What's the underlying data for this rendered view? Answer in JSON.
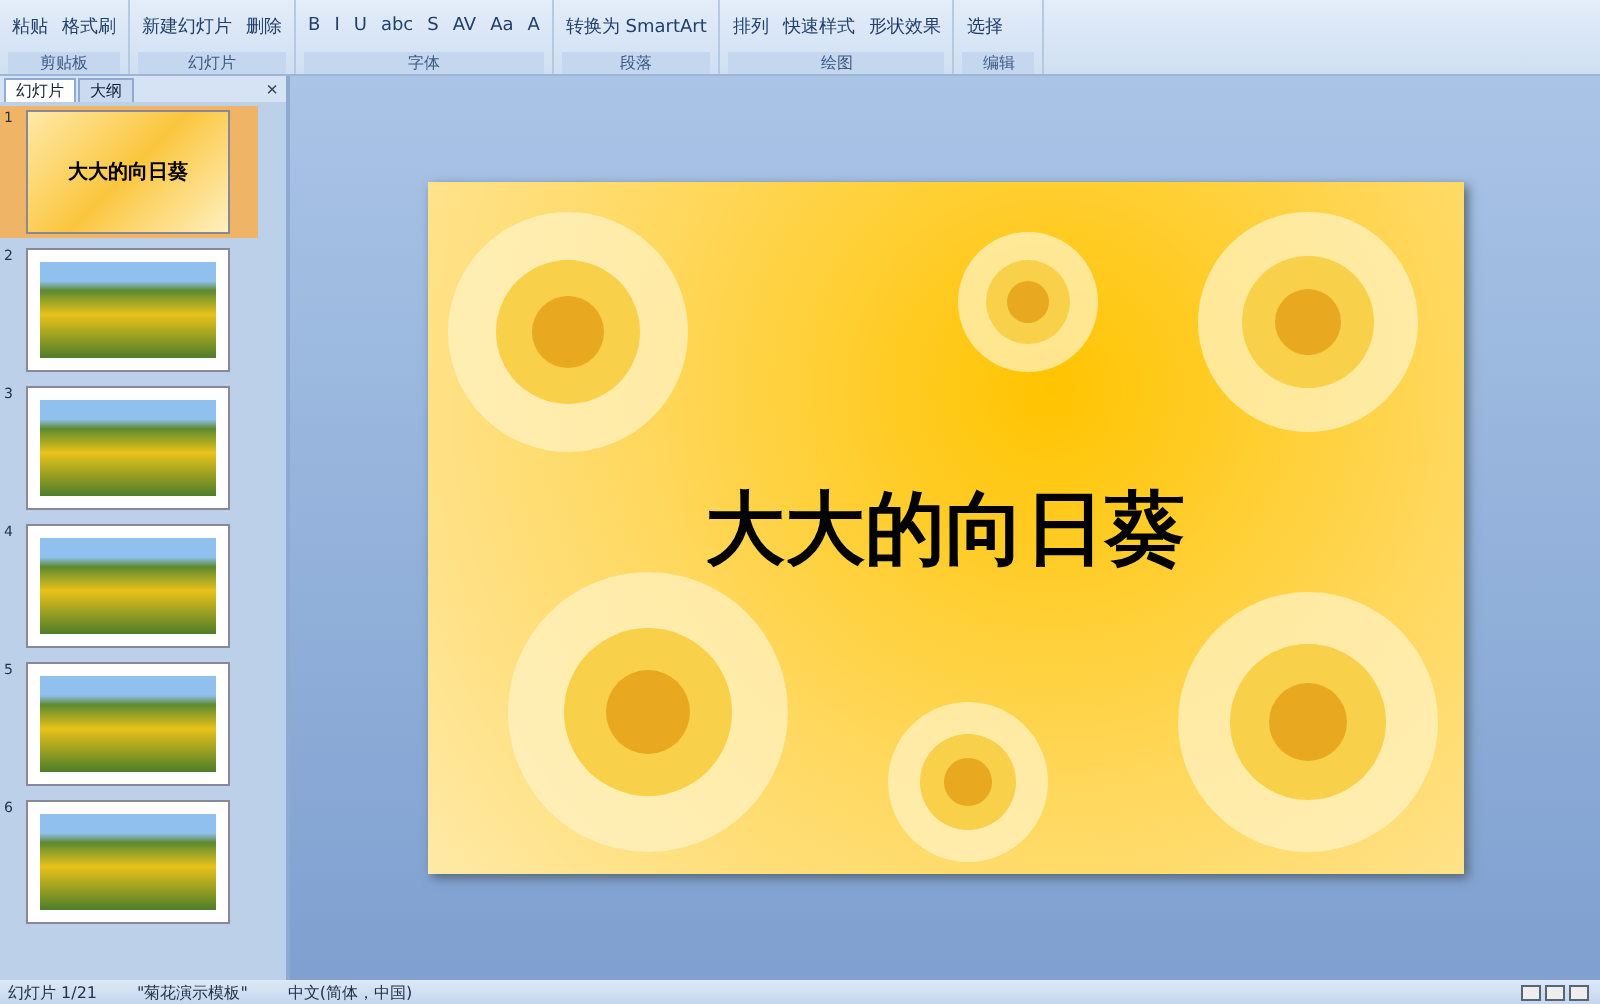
{
  "ribbon": {
    "groups": [
      {
        "label": "剪贴板",
        "items": [
          "粘贴",
          "格式刷"
        ]
      },
      {
        "label": "幻灯片",
        "items": [
          "新建幻灯片",
          "删除"
        ]
      },
      {
        "label": "字体",
        "items": [
          "B",
          "I",
          "U",
          "abc",
          "S",
          "AV",
          "Aa",
          "A"
        ]
      },
      {
        "label": "段落",
        "items": [
          "转换为 SmartArt"
        ]
      },
      {
        "label": "绘图",
        "items": [
          "排列",
          "快速样式",
          "形状效果"
        ]
      },
      {
        "label": "编辑",
        "items": [
          "选择"
        ]
      }
    ]
  },
  "panel": {
    "tabs": [
      {
        "label": "幻灯片",
        "selected": true
      },
      {
        "label": "大纲",
        "selected": false
      }
    ],
    "close": "×"
  },
  "slides": [
    {
      "number": "1",
      "kind": "title",
      "title": "大大的向日葵",
      "selected": true
    },
    {
      "number": "2",
      "kind": "photo",
      "selected": false
    },
    {
      "number": "3",
      "kind": "photo",
      "selected": false
    },
    {
      "number": "4",
      "kind": "photo",
      "selected": false
    },
    {
      "number": "5",
      "kind": "photo",
      "selected": false
    },
    {
      "number": "6",
      "kind": "photo",
      "selected": false
    }
  ],
  "current_slide": {
    "title": "大大的向日葵"
  },
  "status_bar": [
    "幻灯片 1/21",
    "\"菊花演示模板\"",
    "中文(简体，中国)"
  ]
}
